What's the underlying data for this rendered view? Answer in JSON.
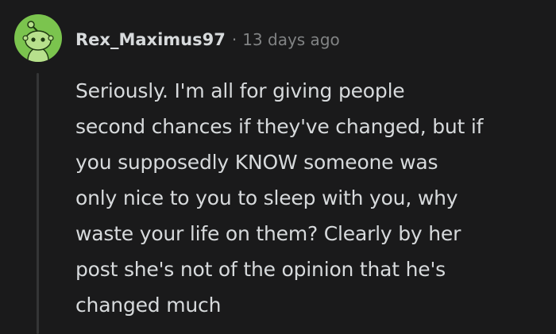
{
  "comment": {
    "username": "Rex_Maximus97",
    "separator": "·",
    "timestamp": "13 days ago",
    "avatar_icon": "snoo-avatar-icon",
    "avatar_color": "#7bc44e",
    "body_lines": [
      "Seriously. I'm all for giving people",
      "second chances if they've changed, but if",
      "you supposedly KNOW someone was",
      "only nice to you to sleep with you, why",
      "waste your life on them? Clearly by her",
      "post she's not of the opinion that he's",
      "changed much"
    ]
  },
  "colors": {
    "background": "#1a1a1b",
    "text": "#d7dadc",
    "meta_text": "#818384",
    "thread_line": "#343536"
  }
}
